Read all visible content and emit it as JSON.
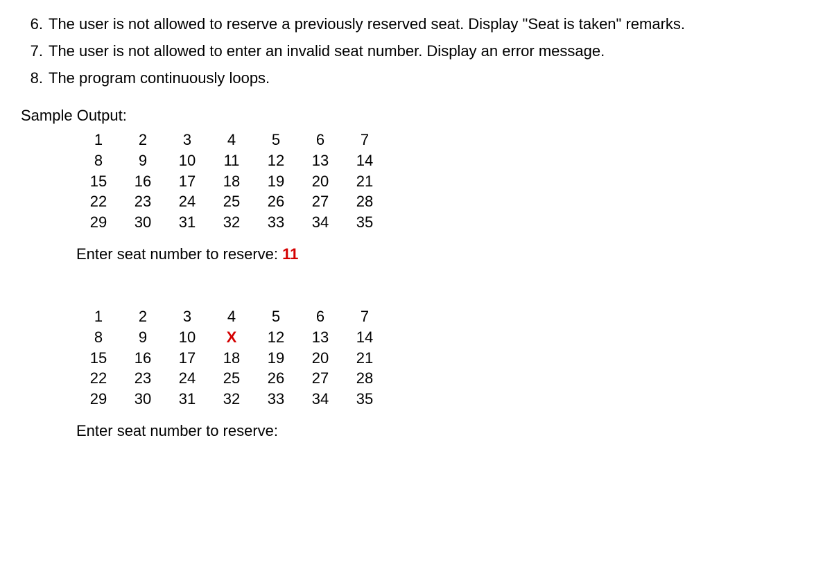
{
  "items": [
    {
      "num": "6.",
      "text": "The user is not allowed to reserve a previously reserved seat.  Display \"Seat is taken\" remarks."
    },
    {
      "num": "7.",
      "text": "The user is not allowed to enter an invalid seat number.  Display an error message."
    },
    {
      "num": "8.",
      "text": "The program continuously loops."
    }
  ],
  "sample_label": "Sample Output:",
  "grid1": [
    [
      "1",
      "2",
      "3",
      "4",
      "5",
      "6",
      "7"
    ],
    [
      "8",
      "9",
      "10",
      "11",
      "12",
      "13",
      "14"
    ],
    [
      "15",
      "16",
      "17",
      "18",
      "19",
      "20",
      "21"
    ],
    [
      "22",
      "23",
      "24",
      "25",
      "26",
      "27",
      "28"
    ],
    [
      "29",
      "30",
      "31",
      "32",
      "33",
      "34",
      "35"
    ]
  ],
  "prompt1_text": "Enter seat number to reserve: ",
  "prompt1_input": "11",
  "grid2": [
    [
      "1",
      "2",
      "3",
      "4",
      "5",
      "6",
      "7"
    ],
    [
      "8",
      "9",
      "10",
      "X",
      "12",
      "13",
      "14"
    ],
    [
      "15",
      "16",
      "17",
      "18",
      "19",
      "20",
      "21"
    ],
    [
      "22",
      "23",
      "24",
      "25",
      "26",
      "27",
      "28"
    ],
    [
      "29",
      "30",
      "31",
      "32",
      "33",
      "34",
      "35"
    ]
  ],
  "reserved_marker": "X",
  "prompt2_text": "Enter seat number to reserve:"
}
